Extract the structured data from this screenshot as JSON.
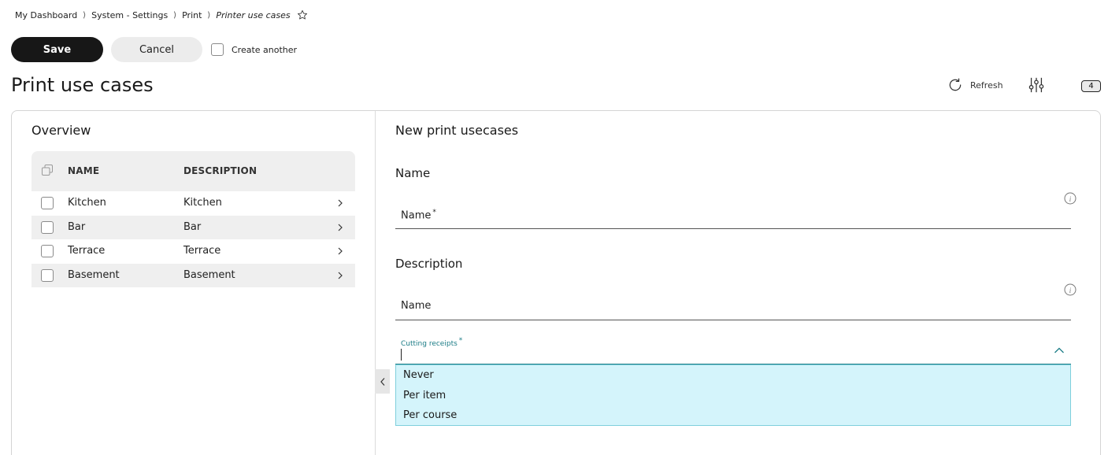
{
  "breadcrumb": {
    "items": [
      "My Dashboard",
      "System - Settings",
      "Print"
    ],
    "current": "Printer use cases",
    "separator": "⟩"
  },
  "toolbar": {
    "save_label": "Save",
    "cancel_label": "Cancel",
    "create_another_label": "Create another",
    "create_another_checked": false
  },
  "page": {
    "title": "Print use cases",
    "refresh_label": "Refresh",
    "count_badge": "4"
  },
  "overview": {
    "title": "Overview",
    "columns": [
      "NAME",
      "DESCRIPTION"
    ],
    "rows": [
      {
        "name": "Kitchen",
        "description": "Kitchen"
      },
      {
        "name": "Bar",
        "description": "Bar"
      },
      {
        "name": "Terrace",
        "description": "Terrace"
      },
      {
        "name": "Basement",
        "description": "Basement"
      }
    ]
  },
  "form": {
    "title": "New print usecases",
    "name_section": "Name",
    "name_field_label": "Name",
    "name_required_mark": "*",
    "description_section": "Description",
    "description_field_label": "Name",
    "cutting_receipts_label": "Cutting receipts",
    "cutting_receipts_required_mark": "*",
    "cutting_receipts_options": [
      "Never",
      "Per item",
      "Per course"
    ]
  },
  "colors": {
    "primary_button": "#171717",
    "accent": "#1b7c86",
    "dropdown_bg": "#d4f4fb",
    "row_alt": "#efefef"
  },
  "icons": [
    "star-icon",
    "refresh-icon",
    "filter-sliders-icon",
    "copy-icon",
    "chevron-right-icon",
    "info-icon",
    "chevron-up-icon",
    "chevron-left-icon"
  ]
}
